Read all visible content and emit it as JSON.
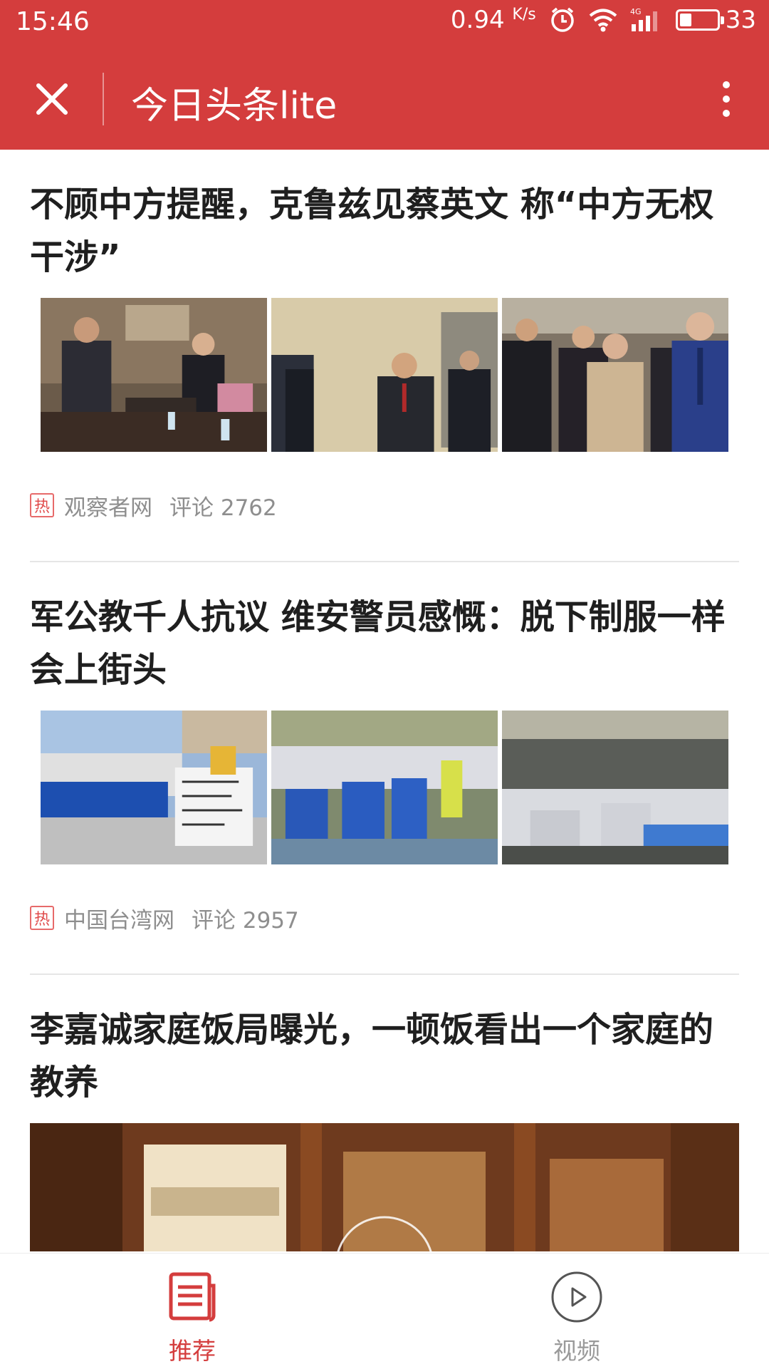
{
  "status_bar": {
    "time": "15:46",
    "speed_value": "0.94",
    "speed_unit": "K/s",
    "network": "4G",
    "battery": "33",
    "battery_level": 0.33
  },
  "app_bar": {
    "title": "今日头条lite",
    "close_icon": "close-icon",
    "more_icon": "more-vertical-icon"
  },
  "feed": {
    "articles": [
      {
        "title": "不顾中方提醒，克鲁兹见蔡英文 称“中方无权干涉”",
        "badge": "热",
        "source": "观察者网",
        "comments": "评论 2762"
      },
      {
        "title": "军公教千人抗议 维安警员感慨：脱下制服一样会上街头",
        "badge": "热",
        "source": "中国台湾网",
        "comments": "评论 2957"
      },
      {
        "title": "李嘉诚家庭饭局曝光，一顿饭看出一个家庭的教养"
      }
    ]
  },
  "bottom_nav": {
    "items": [
      {
        "label": "推荐",
        "icon": "news-icon",
        "active": true
      },
      {
        "label": "视频",
        "icon": "play-circle-icon",
        "active": false
      }
    ]
  },
  "colors": {
    "brand_red": "#d43d3d",
    "title_text": "#1f1f1f",
    "meta_text": "#8e8e8e",
    "inactive_nav": "#9a9a9a"
  }
}
